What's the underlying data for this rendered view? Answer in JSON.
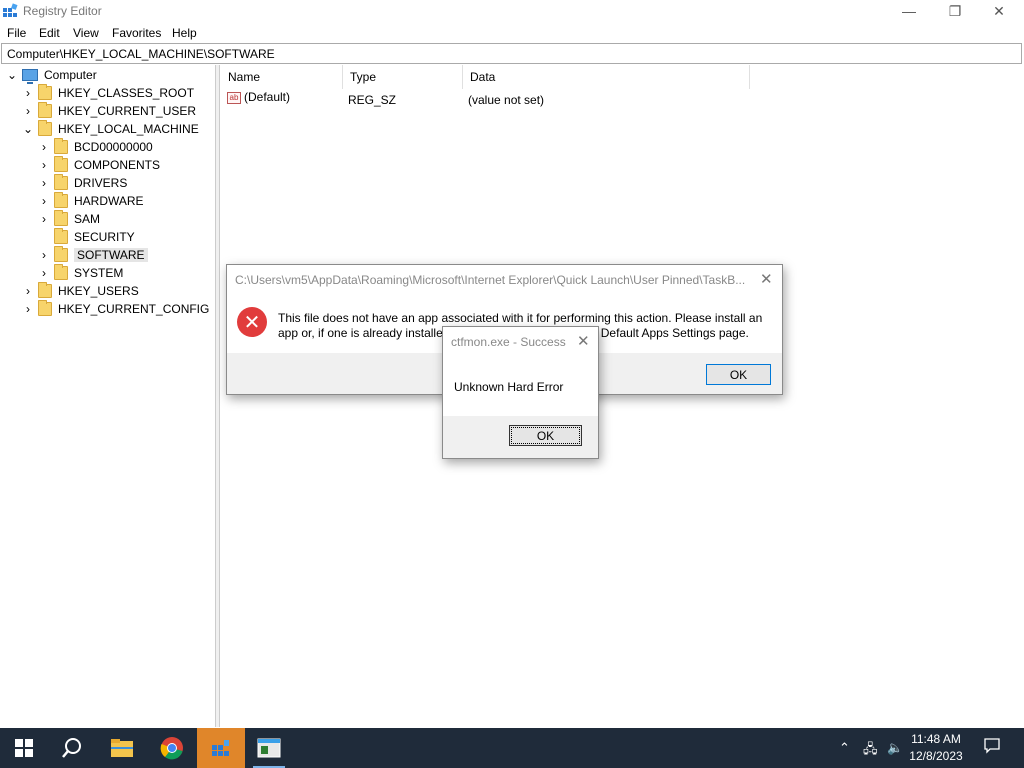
{
  "window": {
    "title": "Registry Editor",
    "controls": {
      "minimize": "—",
      "restore": "❐",
      "close": "✕"
    }
  },
  "menu": [
    "File",
    "Edit",
    "View",
    "Favorites",
    "Help"
  ],
  "address": "Computer\\HKEY_LOCAL_MACHINE\\SOFTWARE",
  "tree": {
    "root": "Computer",
    "hives": [
      "HKEY_CLASSES_ROOT",
      "HKEY_CURRENT_USER",
      "HKEY_LOCAL_MACHINE",
      "HKEY_USERS",
      "HKEY_CURRENT_CONFIG"
    ],
    "hklm_children": [
      "BCD00000000",
      "COMPONENTS",
      "DRIVERS",
      "HARDWARE",
      "SAM",
      "SECURITY",
      "SOFTWARE",
      "SYSTEM"
    ],
    "selected": "SOFTWARE"
  },
  "values": {
    "columns": [
      "Name",
      "Type",
      "Data"
    ],
    "rows": [
      {
        "icon": "ab",
        "name": "(Default)",
        "type": "REG_SZ",
        "data": "(value not set)"
      }
    ]
  },
  "error_dialog": {
    "title": "C:\\Users\\vm5\\AppData\\Roaming\\Microsoft\\Internet Explorer\\Quick Launch\\User Pinned\\TaskB...",
    "message_line1": "This file does not have an app associated with it for performing this action. Please install an",
    "message_line2_left": "app or, if one is already installe",
    "message_line2_right": "Default Apps Settings page.",
    "icon": "error-x-icon",
    "ok_label": "OK"
  },
  "ctfmon_dialog": {
    "title": "ctfmon.exe - Success",
    "message": "Unknown Hard Error",
    "ok_label": "OK"
  },
  "taskbar": {
    "time": "11:48 AM",
    "date": "12/8/2023",
    "accent_active": "#e0862a"
  }
}
